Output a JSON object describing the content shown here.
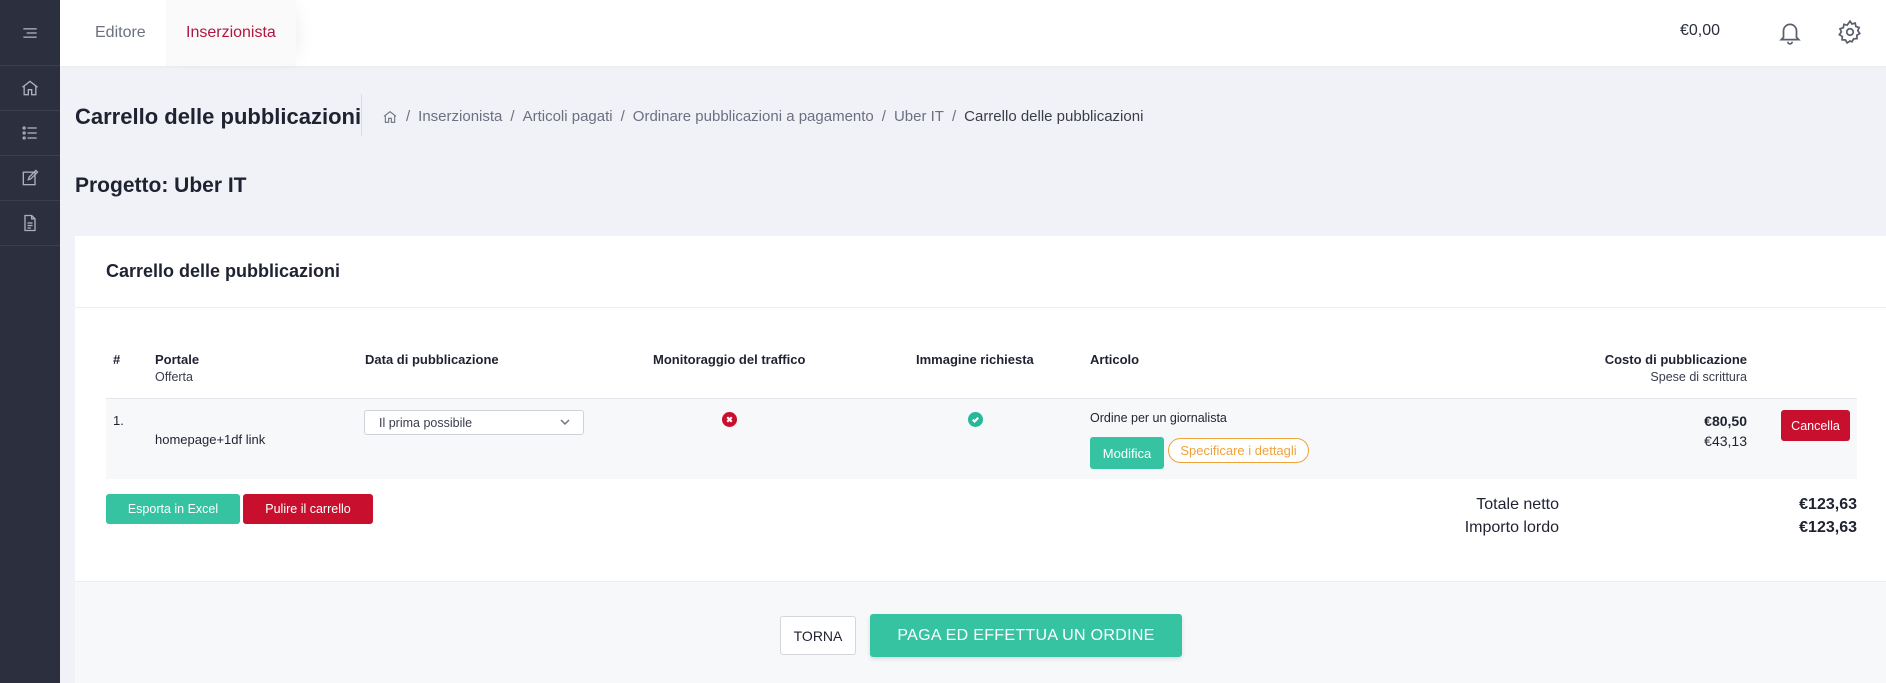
{
  "sidebar": {
    "items": [
      {
        "icon": "menu-icon"
      },
      {
        "icon": "home-icon"
      },
      {
        "icon": "list-icon"
      },
      {
        "icon": "edit-icon"
      },
      {
        "icon": "document-icon"
      }
    ]
  },
  "topbar": {
    "tabs": [
      {
        "label": "Editore"
      },
      {
        "label": "Inserzionista"
      }
    ],
    "balance": "€0,00"
  },
  "page": {
    "title": "Carrello delle pubblicazioni",
    "breadcrumb": [
      "Inserzionista",
      "Articoli pagati",
      "Ordinare pubblicazioni a pagamento",
      "Uber IT",
      "Carrello delle pubblicazioni"
    ],
    "project_title": "Progetto: Uber IT"
  },
  "cart": {
    "title": "Carrello delle pubblicazioni",
    "columns": {
      "num": "#",
      "portale": "Portale",
      "offerta": "Offerta",
      "data": "Data di pubblicazione",
      "monitoraggio": "Monitoraggio del traffico",
      "immagine": "Immagine richiesta",
      "articolo": "Articolo",
      "costo": "Costo di pubblicazione",
      "spese": "Spese di scrittura"
    },
    "rows": [
      {
        "num": "1.",
        "portale": "",
        "offerta": "homepage+1df link",
        "data": "Il prima possibile",
        "monitoraggio": false,
        "immagine": true,
        "articolo": "Ordine per un giornalista",
        "modifica_label": "Modifica",
        "dettagli_label": "Specificare i dettagli",
        "costo": "€80,50",
        "spese": "€43,13",
        "cancella_label": "Cancella"
      }
    ],
    "export_label": "Esporta in Excel",
    "clear_label": "Pulire il carrello",
    "totals": {
      "netto_label": "Totale netto",
      "netto_value": "€123,63",
      "lordo_label": "Importo lordo",
      "lordo_value": "€123,63"
    },
    "back_label": "TORNA",
    "pay_label": "PAGA ED EFFETTUA UN ORDINE"
  },
  "colors": {
    "accent_green": "#35c3a2",
    "accent_red": "#c8102e",
    "accent_orange": "#f0a23b",
    "sidebar_bg": "#2b2f3e",
    "brand_tab": "#b0173e"
  }
}
